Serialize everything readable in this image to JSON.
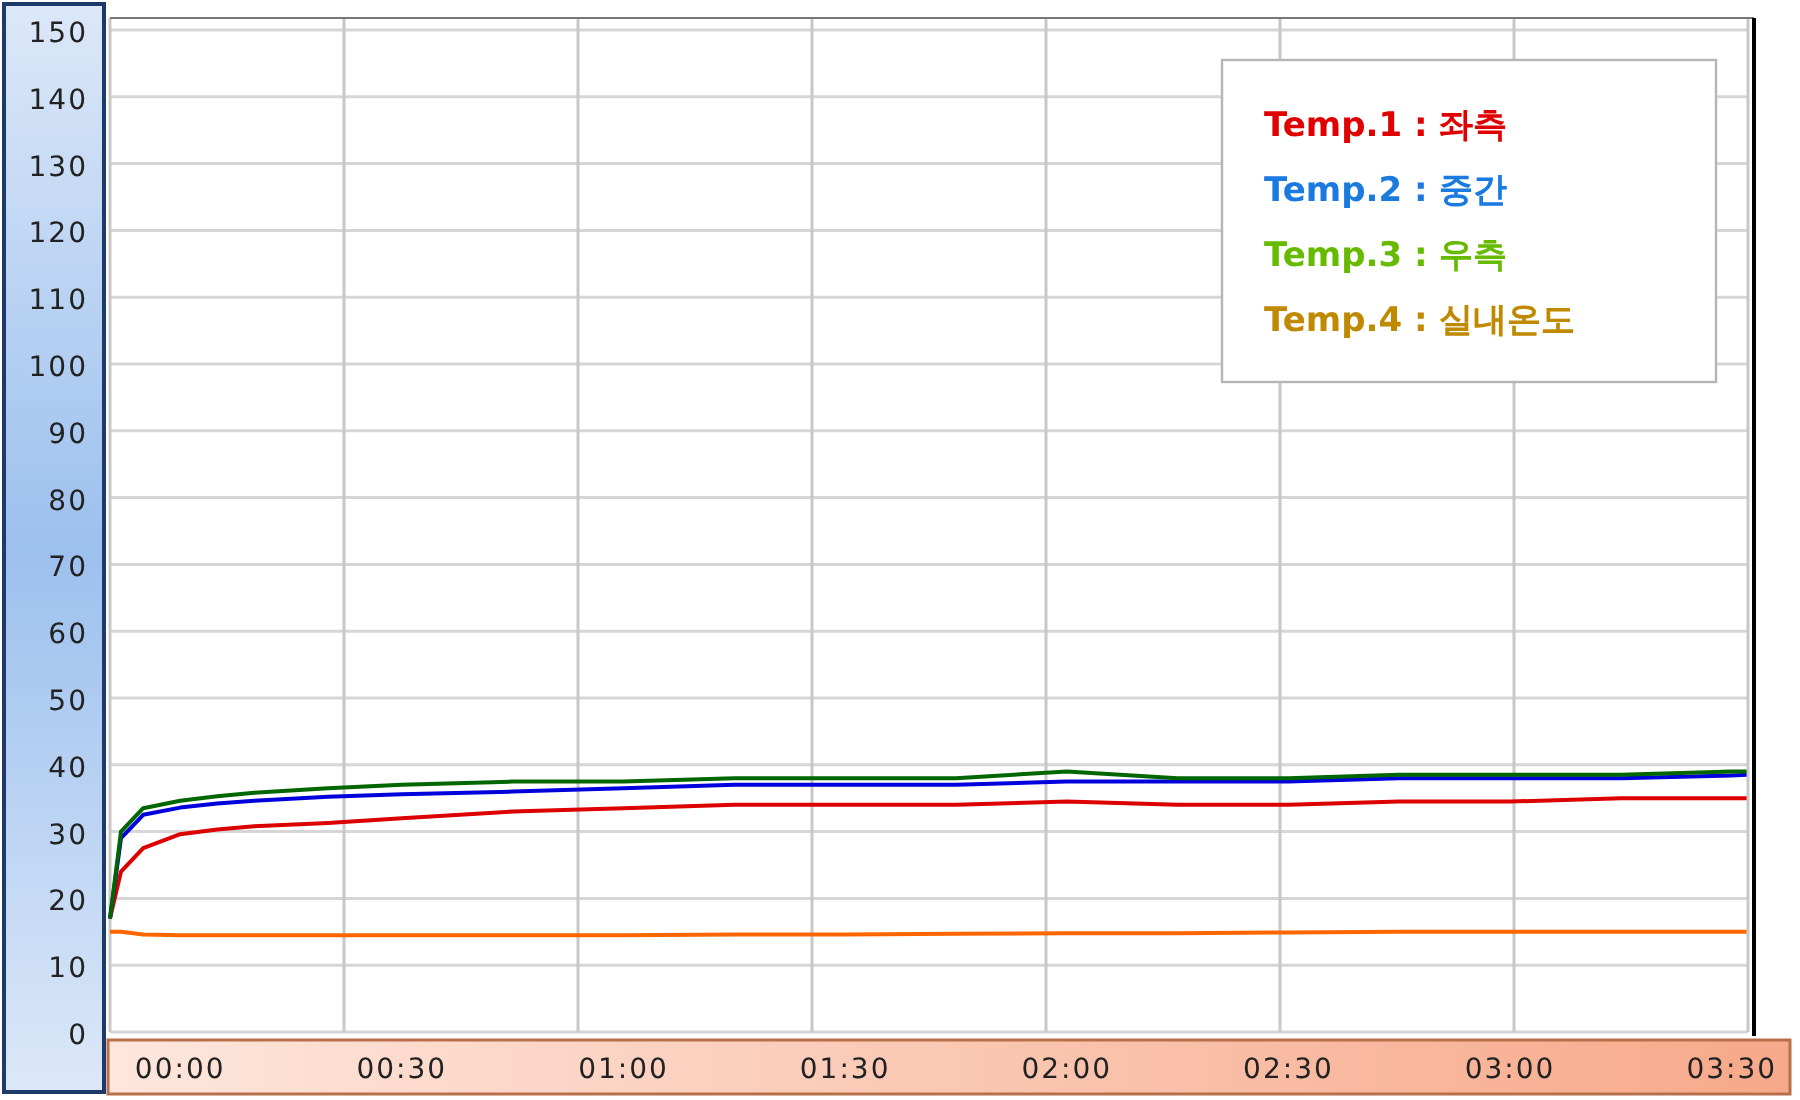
{
  "chart": {
    "legend": [
      {
        "label": "Temp.1 : 좌측",
        "color": "#e00000"
      },
      {
        "label": "Temp.2 : 중간",
        "color": "#1a7ae0"
      },
      {
        "label": "Temp.3 : 우측",
        "color": "#66bb00"
      },
      {
        "label": "Temp.4 : 실내온도",
        "color": "#c08a00"
      }
    ],
    "chart_data": {
      "type": "line",
      "x": [
        -9.5,
        -8,
        -5,
        0,
        5,
        10,
        20,
        30,
        45,
        60,
        75,
        90,
        105,
        120,
        135,
        150,
        165,
        180,
        195,
        210,
        212
      ],
      "series": [
        {
          "color": "#dd0000",
          "values": [
            17,
            24,
            27.5,
            29.6,
            30.3,
            30.8,
            31.3,
            32,
            33,
            33.5,
            34,
            34,
            34,
            34.5,
            34,
            34,
            34.5,
            34.5,
            35,
            35,
            35
          ]
        },
        {
          "color": "#0000dd",
          "values": [
            17,
            29,
            32.5,
            33.6,
            34.2,
            34.6,
            35.2,
            35.6,
            36,
            36.5,
            37,
            37,
            37,
            37.5,
            37.5,
            37.5,
            38,
            38,
            38,
            38.4,
            38.5
          ]
        },
        {
          "color": "#006600",
          "values": [
            17,
            30,
            33.5,
            34.6,
            35.3,
            35.8,
            36.5,
            37,
            37.5,
            37.5,
            38,
            38,
            38,
            39,
            38,
            38,
            38.5,
            38.5,
            38.5,
            39,
            39
          ]
        },
        {
          "color": "#ff6600",
          "values": [
            15,
            15,
            14.6,
            14.5,
            14.5,
            14.5,
            14.5,
            14.5,
            14.5,
            14.5,
            14.6,
            14.6,
            14.7,
            14.8,
            14.8,
            14.9,
            15,
            15,
            15,
            15,
            15
          ]
        }
      ],
      "xlim": [
        -9.5,
        212.2
      ],
      "ylim": [
        0,
        150
      ],
      "grid": true,
      "xticks": [
        {
          "value": 0,
          "label": "00:00"
        },
        {
          "value": 30,
          "label": "00:30"
        },
        {
          "value": 60,
          "label": "01:00"
        },
        {
          "value": 90,
          "label": "01:30"
        },
        {
          "value": 120,
          "label": "02:00"
        },
        {
          "value": 150,
          "label": "02:30"
        },
        {
          "value": 180,
          "label": "03:00"
        },
        {
          "value": 210,
          "label": "03:30"
        }
      ],
      "yticks": [
        0,
        10,
        20,
        30,
        40,
        50,
        60,
        70,
        80,
        90,
        100,
        110,
        120,
        130,
        140,
        150
      ]
    }
  }
}
